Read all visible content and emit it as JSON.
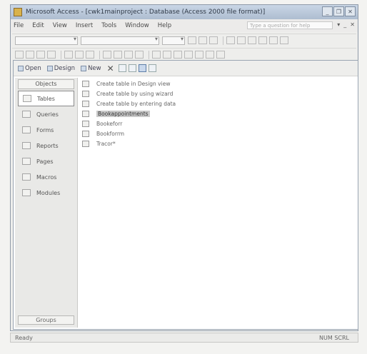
{
  "window": {
    "title": "Microsoft Access - [cwk1mainproject : Database (Access 2000 file format)]"
  },
  "menubar": {
    "items": [
      "File",
      "Edit",
      "View",
      "Insert",
      "Tools",
      "Window",
      "Help"
    ],
    "help_placeholder": "Type a question for help"
  },
  "db_toolbar": {
    "open_label": "Open",
    "design_label": "Design",
    "new_label": "New"
  },
  "objects_bar": {
    "header": "Objects",
    "items": [
      "Tables",
      "Queries",
      "Forms",
      "Reports",
      "Pages",
      "Macros",
      "Modules"
    ],
    "groups_label": "Groups"
  },
  "list": {
    "items": [
      "Create table in Design view",
      "Create table by using wizard",
      "Create table by entering data",
      "Bookappointments",
      "Bookeforr",
      "Bookforrm",
      "Tracor*"
    ]
  },
  "statusbar": {
    "left": "Ready",
    "right": "NUM  SCRL"
  }
}
